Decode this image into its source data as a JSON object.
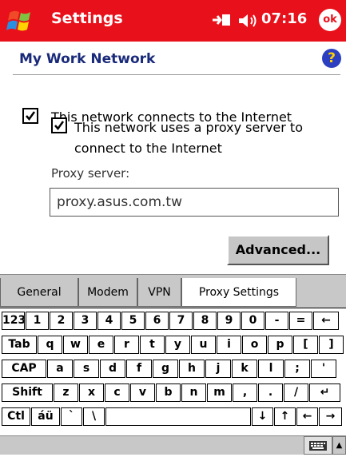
{
  "titlebar": {
    "app_title": "Settings",
    "time": "07:16",
    "ok_label": "ok",
    "bg_color": "#e8101a"
  },
  "header": {
    "title": "My Work Network",
    "help_label": "?"
  },
  "options": {
    "internet_label": "This network connects to the Internet",
    "internet_checked": true,
    "proxy_label": "This network uses a proxy server to connect to the Internet",
    "proxy_checked": true
  },
  "proxy": {
    "label": "Proxy server:",
    "value": "proxy.asus.com.tw"
  },
  "advanced_button": "Advanced...",
  "tabs": [
    "General",
    "Modem",
    "VPN",
    "Proxy Settings"
  ],
  "active_tab": "Proxy Settings",
  "keyboard": {
    "row1": [
      "123",
      "1",
      "2",
      "3",
      "4",
      "5",
      "6",
      "7",
      "8",
      "9",
      "0",
      "-",
      "=",
      "←"
    ],
    "row2": [
      "Tab",
      "q",
      "w",
      "e",
      "r",
      "t",
      "y",
      "u",
      "i",
      "o",
      "p",
      "[",
      "]"
    ],
    "row3": [
      "CAP",
      "a",
      "s",
      "d",
      "f",
      "g",
      "h",
      "j",
      "k",
      "l",
      ";",
      "'"
    ],
    "row4": [
      "Shift",
      "z",
      "x",
      "c",
      "v",
      "b",
      "n",
      "m",
      ",",
      ".",
      "/",
      "↵"
    ],
    "row5": [
      "Ctl",
      "áü",
      "`",
      "\\",
      "",
      "↓",
      "↑",
      "←",
      "→"
    ]
  }
}
